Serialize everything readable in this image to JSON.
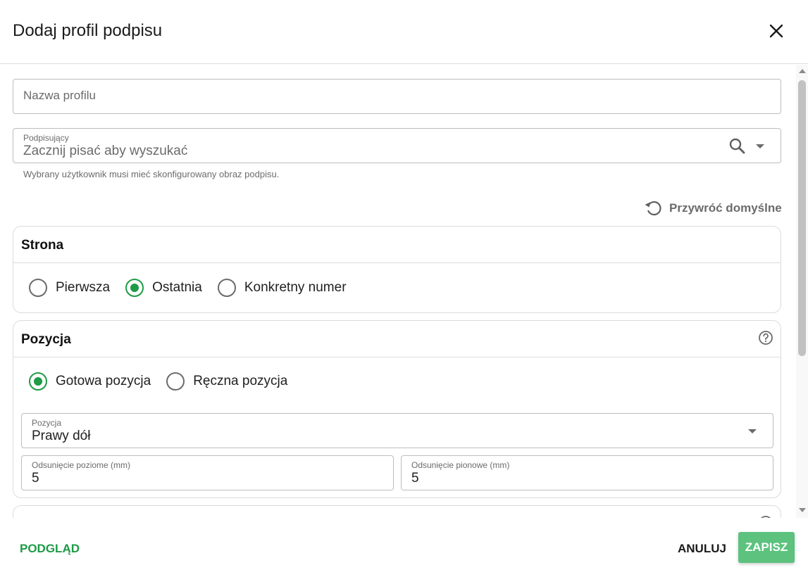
{
  "dialog": {
    "title": "Dodaj profil podpisu"
  },
  "form": {
    "profile_name": {
      "placeholder": "Nazwa profilu",
      "value": ""
    },
    "signer": {
      "label": "Podpisujący",
      "placeholder": "Zacznij pisać aby wyszukać",
      "helper": "Wybrany użytkownik musi mieć skonfigurowany obraz podpisu."
    },
    "reset_label": "Przywróć domyślne"
  },
  "page_section": {
    "title": "Strona",
    "options": [
      {
        "label": "Pierwsza",
        "selected": false
      },
      {
        "label": "Ostatnia",
        "selected": true
      },
      {
        "label": "Konkretny numer",
        "selected": false
      }
    ]
  },
  "position_section": {
    "title": "Pozycja",
    "options": [
      {
        "label": "Gotowa pozycja",
        "selected": true
      },
      {
        "label": "Ręczna pozycja",
        "selected": false
      }
    ],
    "position_select": {
      "label": "Pozycja",
      "value": "Prawy dół"
    },
    "offset_horizontal": {
      "label": "Odsunięcie poziome (mm)",
      "value": "5"
    },
    "offset_vertical": {
      "label": "Odsunięcie pionowe (mm)",
      "value": "5"
    }
  },
  "footer": {
    "preview_label": "PODGLĄD",
    "cancel_label": "ANULUJ",
    "save_label": "ZAPISZ"
  },
  "colors": {
    "accent": "#1e9b46",
    "save_button": "#5cc27e"
  },
  "icons": [
    "close-icon",
    "search-icon",
    "chevron-down-icon",
    "reset-icon",
    "help-icon"
  ]
}
